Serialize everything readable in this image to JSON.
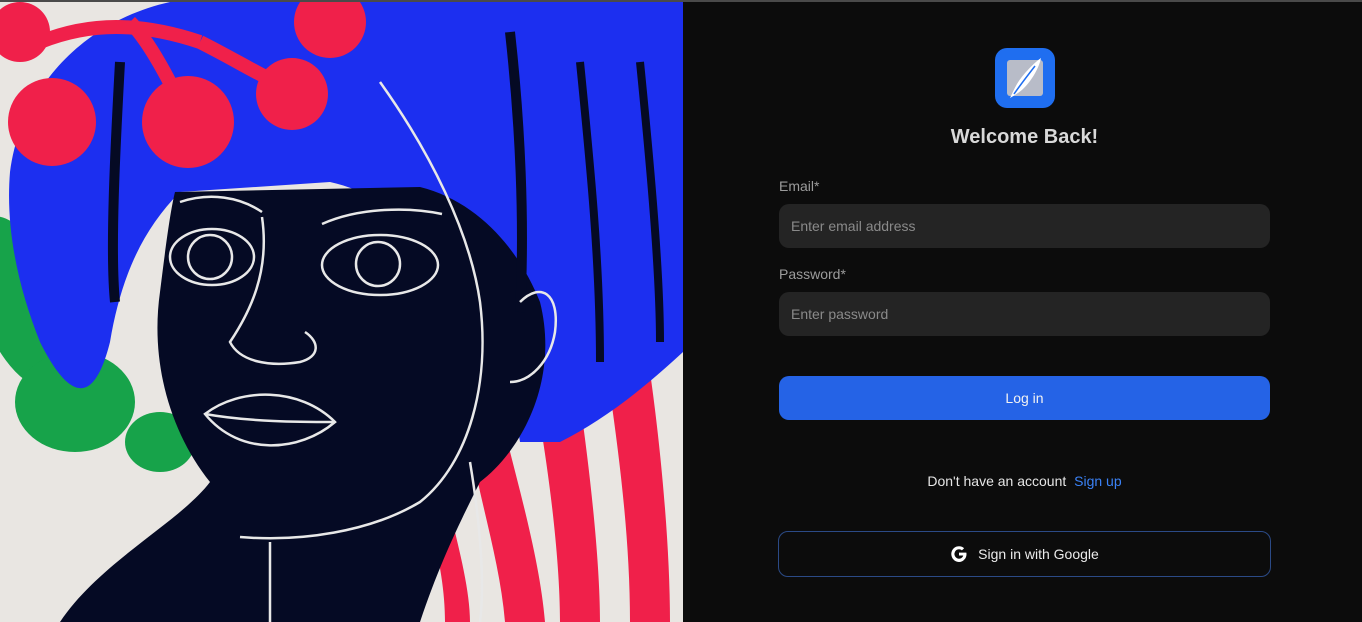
{
  "header": {
    "title": "Welcome Back!"
  },
  "form": {
    "email_label": "Email*",
    "email_placeholder": "Enter email address",
    "email_value": "",
    "password_label": "Password*",
    "password_placeholder": "Enter password",
    "password_value": "",
    "login_label": "Log in"
  },
  "signup": {
    "prompt": "Don't have an account",
    "link_label": "Sign up"
  },
  "google": {
    "label": "Sign in with Google",
    "icon": "google-g-icon"
  },
  "logo": {
    "icon": "quill-pen-icon"
  },
  "colors": {
    "accent": "#2563e6",
    "link": "#3b82f6",
    "panel_bg": "#0c0c0c",
    "input_bg": "#242424",
    "logo_bg": "#1f6ef0"
  }
}
